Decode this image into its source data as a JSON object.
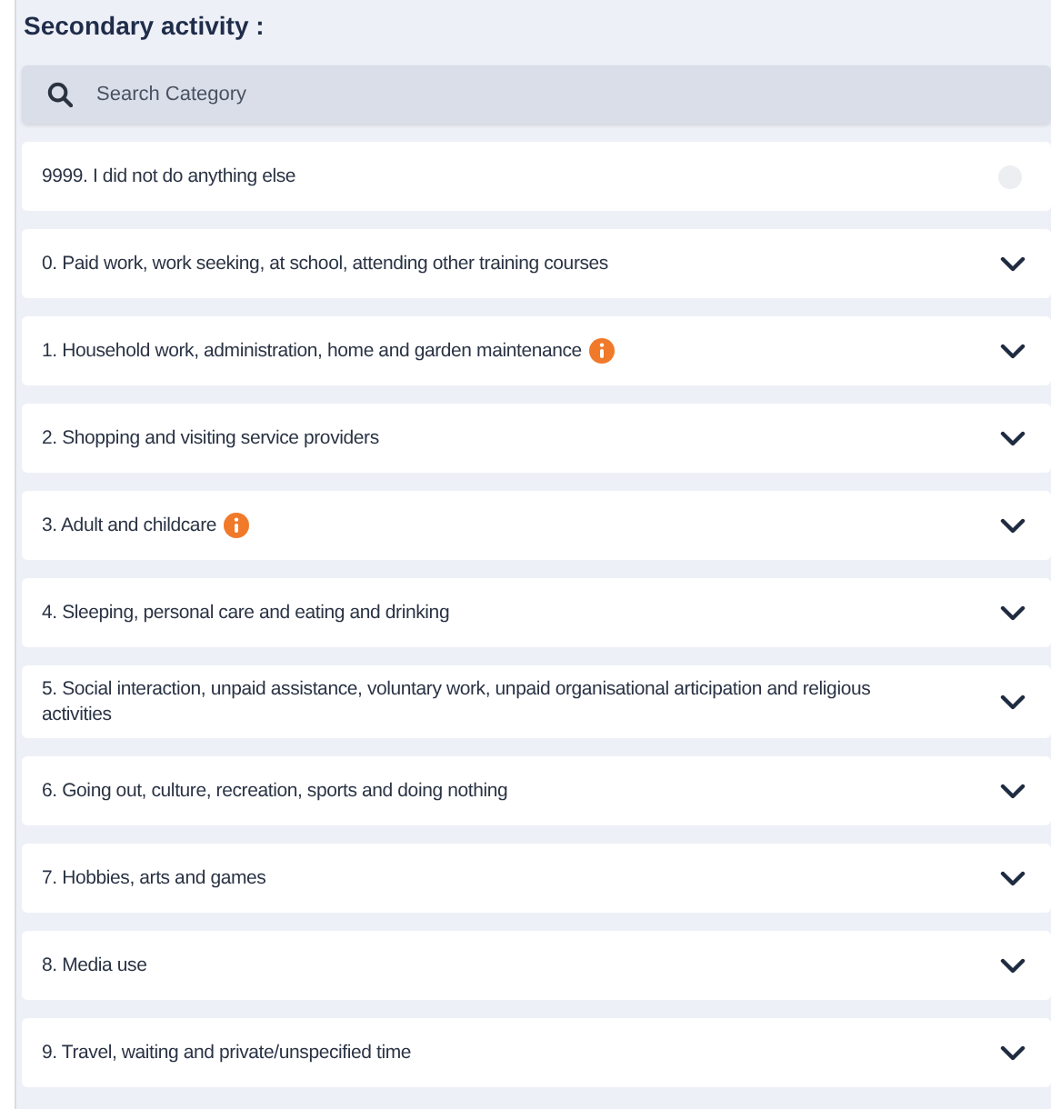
{
  "title": "Secondary activity :",
  "search": {
    "placeholder": "Search Category"
  },
  "items": [
    {
      "kind": "option",
      "label": "9999. I did not do anything else",
      "checked": false
    },
    {
      "kind": "category",
      "label": "0. Paid work, work seeking, at school, attending other training courses",
      "info": false,
      "expanded": false
    },
    {
      "kind": "category",
      "label": "1. Household work, administration, home and garden maintenance",
      "info": true,
      "expanded": false
    },
    {
      "kind": "category",
      "label": "2. Shopping and visiting service providers",
      "info": false,
      "expanded": false
    },
    {
      "kind": "category",
      "label": "3. Adult and childcare",
      "info": true,
      "expanded": false
    },
    {
      "kind": "category",
      "label": "4. Sleeping, personal care and eating and drinking",
      "info": false,
      "expanded": false
    },
    {
      "kind": "category",
      "label": "5. Social interaction, unpaid assistance, voluntary work, unpaid organisational articipation and religious activities",
      "info": false,
      "expanded": false
    },
    {
      "kind": "category",
      "label": "6. Going out, culture, recreation, sports and doing nothing",
      "info": false,
      "expanded": false
    },
    {
      "kind": "category",
      "label": "7. Hobbies, arts and games",
      "info": false,
      "expanded": false
    },
    {
      "kind": "category",
      "label": "8. Media use",
      "info": false,
      "expanded": false
    },
    {
      "kind": "category",
      "label": "9. Travel, waiting and private/unspecified time",
      "info": false,
      "expanded": false
    }
  ]
}
